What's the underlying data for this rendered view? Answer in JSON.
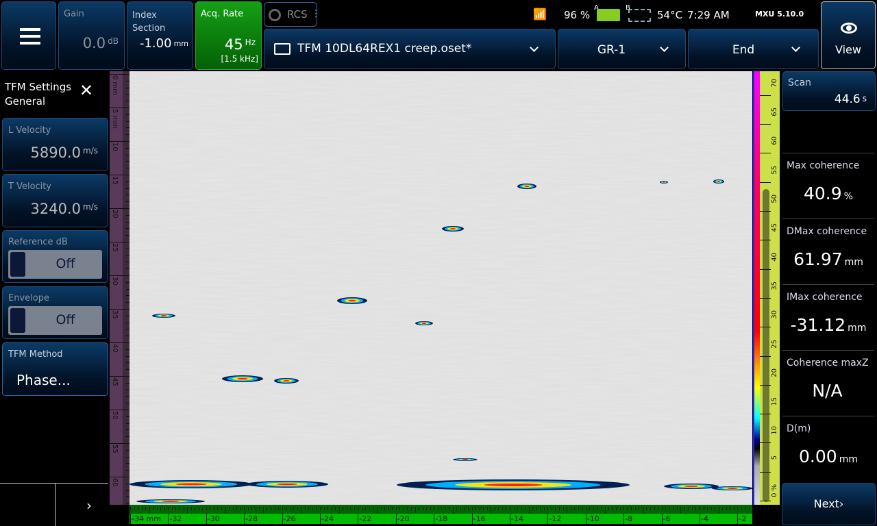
{
  "toolbar": {
    "menu_icon": "hamburger-icon",
    "gain": {
      "label": "Gain",
      "value": "0.0",
      "unit": "dB"
    },
    "index_section": {
      "label": "Index Section",
      "value": "-1.00",
      "unit": "mm"
    },
    "acq_rate": {
      "label": "Acq. Rate",
      "value": "45",
      "unit": "Hz",
      "sub": "[1.5 kHz]",
      "color": "#0a8a0a"
    },
    "rcs": {
      "label": "RCS"
    },
    "file": {
      "name": "TFM 10DL64REX1 creep.oset*",
      "icon": "folder-open-icon"
    },
    "group": {
      "value": "GR-1"
    },
    "mode": {
      "value": "End"
    },
    "view": {
      "label": "View",
      "icon": "eye-icon"
    }
  },
  "status": {
    "wifi": "wifi-off-icon",
    "battery_percent": "96 %",
    "battery_a": "A",
    "battery_b": "B",
    "temperature": "54°C",
    "time": "7:29 AM",
    "version": "MXU 5.10.0"
  },
  "left_panel": {
    "title": "TFM Settings General",
    "l_velocity": {
      "label": "L Velocity",
      "value": "5890.0",
      "unit": "m/s"
    },
    "t_velocity": {
      "label": "T Velocity",
      "value": "3240.0",
      "unit": "m/s"
    },
    "reference_db": {
      "label": "Reference dB",
      "state": "Off"
    },
    "envelope": {
      "label": "Envelope",
      "state": "Off"
    },
    "tfm_method": {
      "label": "TFM Method",
      "value": "Phase..."
    }
  },
  "depth_axis": {
    "unit": "mm",
    "ticks": [
      "0 mm",
      "5 mm",
      "10",
      "15",
      "20",
      "25",
      "30",
      "35",
      "40",
      "45",
      "50",
      "55",
      "60"
    ]
  },
  "index_axis": {
    "unit": "mm",
    "ticks": [
      "-34 mm",
      "-32",
      "-30",
      "-28",
      "-26",
      "-24",
      "-22",
      "-20",
      "-18",
      "-16",
      "-14",
      "-12",
      "-10",
      "-8",
      "-6",
      "-4",
      "-2"
    ]
  },
  "amplitude_scale": {
    "ticks": [
      "0 %",
      "5",
      "10",
      "15",
      "20",
      "25",
      "30",
      "35",
      "40",
      "45",
      "50",
      "55",
      "60",
      "65",
      "70"
    ],
    "level_percent": 54
  },
  "right_panel": {
    "scan": {
      "label": "Scan",
      "value": "44.6",
      "unit": "s"
    },
    "readings": [
      {
        "label": "Max coherence",
        "value": "40.9",
        "unit": "%"
      },
      {
        "label": "DMax coherence",
        "value": "61.97",
        "unit": "mm"
      },
      {
        "label": "IMax coherence",
        "value": "-31.12",
        "unit": "mm"
      },
      {
        "label": "Coherence maxZ",
        "value": "N/A",
        "unit": ""
      },
      {
        "label": "D(m)",
        "value": "0.00",
        "unit": "mm"
      }
    ],
    "next": "Next›"
  }
}
